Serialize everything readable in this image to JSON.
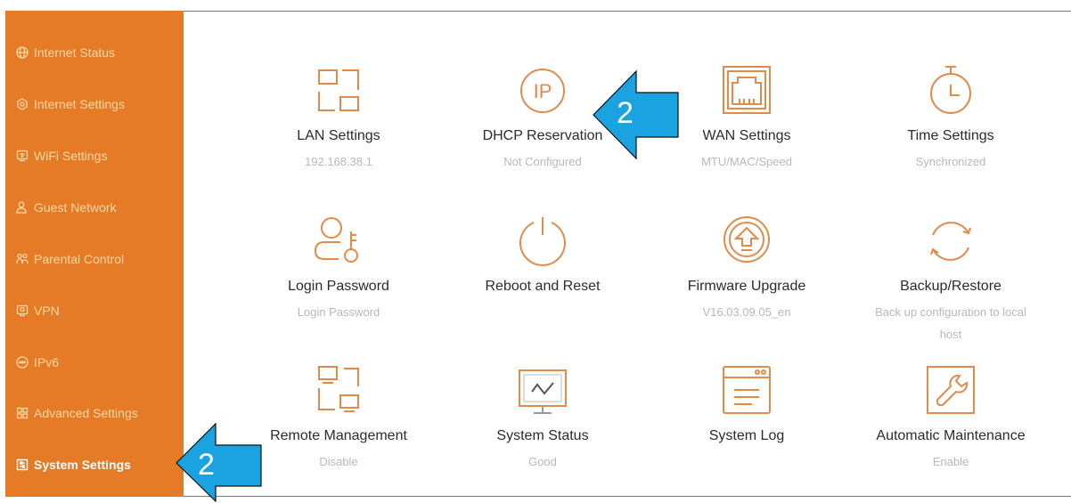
{
  "colors": {
    "sidebar": "#e57b26",
    "icon_stroke": "#e08a4c",
    "annotation_arrow": "#1aa3e0"
  },
  "sidebar": {
    "items": [
      {
        "label": "Internet Status",
        "icon": "globe-icon"
      },
      {
        "label": "Internet Settings",
        "icon": "gear-icon"
      },
      {
        "label": "WiFi Settings",
        "icon": "wifi-icon"
      },
      {
        "label": "Guest Network",
        "icon": "user-icon"
      },
      {
        "label": "Parental Control",
        "icon": "family-icon"
      },
      {
        "label": "VPN",
        "icon": "vpn-icon"
      },
      {
        "label": "IPv6",
        "icon": "ipv6-icon"
      },
      {
        "label": "Advanced Settings",
        "icon": "grid-icon"
      },
      {
        "label": "System Settings",
        "icon": "system-settings-icon",
        "active": true
      }
    ]
  },
  "tiles": [
    {
      "label": "LAN Settings",
      "sub": "192.168.38.1",
      "icon": "lan-icon"
    },
    {
      "label": "DHCP Reservation",
      "sub": "Not Configured",
      "icon": "ip-icon",
      "icon_text": "IP"
    },
    {
      "label": "WAN Settings",
      "sub": "MTU/MAC/Speed",
      "icon": "ethernet-port-icon"
    },
    {
      "label": "Time Settings",
      "sub": "Synchronized",
      "icon": "stopwatch-icon"
    },
    {
      "label": "Login Password",
      "sub": "Login Password",
      "icon": "user-key-icon"
    },
    {
      "label": "Reboot and Reset",
      "sub": "",
      "icon": "power-icon"
    },
    {
      "label": "Firmware Upgrade",
      "sub": "V16.03.09.05_en",
      "icon": "upgrade-icon"
    },
    {
      "label": "Backup/Restore",
      "sub": "Back up configuration to local host",
      "icon": "sync-icon"
    },
    {
      "label": "Remote Management",
      "sub": "Disable",
      "icon": "remote-icon"
    },
    {
      "label": "System Status",
      "sub": "Good",
      "icon": "monitor-icon"
    },
    {
      "label": "System Log",
      "sub": "",
      "icon": "log-icon"
    },
    {
      "label": "Automatic Maintenance",
      "sub": "Enable",
      "icon": "wrench-icon"
    }
  ],
  "annotations": [
    {
      "number": "2"
    },
    {
      "number": "2"
    }
  ]
}
